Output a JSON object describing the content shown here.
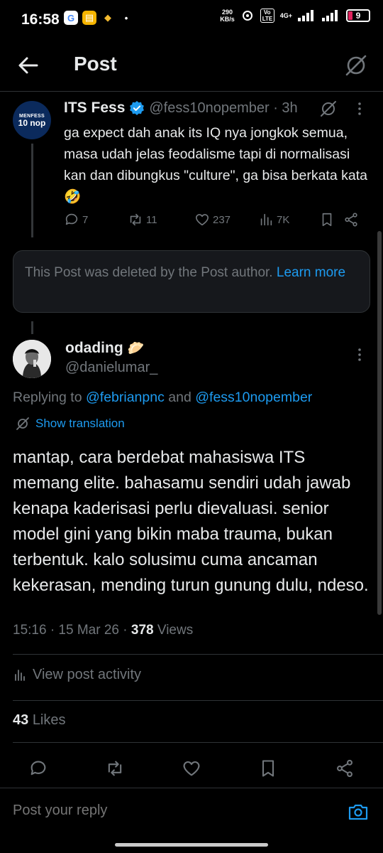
{
  "status_bar": {
    "time": "16:58",
    "apps": [
      {
        "icon": "google-icon",
        "glyph": "G",
        "bg": "#ffffff",
        "fg": "#4285f4"
      },
      {
        "icon": "notes-app-icon",
        "glyph": "▤",
        "bg": "#f5b400",
        "fg": "#ffffff"
      },
      {
        "icon": "binance-icon",
        "glyph": "◆",
        "bg": "#000000",
        "fg": "#f3ba2f"
      },
      {
        "icon": "more-dots-icon",
        "glyph": "•",
        "bg": "#000000",
        "fg": "#ffffff"
      }
    ],
    "speed_value": "290",
    "speed_unit": "KB/s",
    "volte": "Vo LTE",
    "network": "4G+",
    "battery": "9"
  },
  "header": {
    "title": "Post"
  },
  "parent_post": {
    "avatar_line1": "MENFESS",
    "avatar_line2": "10 nop",
    "name": "ITS Fess",
    "handle_time": "@fess10nopember · 3h",
    "text": "ga expect dah anak its IQ nya jongkok semua, masa udah jelas feodalisme tapi di normalisasi kan dan dibungkus \"culture\", ga bisa berkata kata 🤣",
    "replies": "7",
    "reposts": "11",
    "likes": "237",
    "views": "7K"
  },
  "deleted_notice": {
    "text": "This Post was deleted by the Post author.",
    "link": "Learn more"
  },
  "main_post": {
    "name": "odading",
    "name_emoji": "🥟",
    "handle": "@danielumar_",
    "replying_prefix": "Replying to",
    "mention1": "@febrianpnc",
    "replying_and": "and",
    "mention2": "@fess10nopember",
    "show_translation": "Show translation",
    "text": "mantap, cara berdebat mahasiswa ITS memang elite. bahasamu sendiri udah jawab kenapa kaderisasi perlu dievaluasi. senior model gini yang bikin maba trauma, bukan terbentuk. kalo solusimu cuma ancaman kekerasan, mending turun gunung dulu, ndeso.",
    "time_date": "15:16 · 15 Mar 26 ·",
    "views_count": "378",
    "views_label": "Views",
    "activity": "View post activity",
    "likes_count": "43",
    "likes_label": "Likes"
  },
  "reply_bar": {
    "placeholder": "Post your reply"
  },
  "colors": {
    "background": "#000000",
    "accent": "#1d9bf0",
    "muted": "#71767b",
    "text": "#e7e9ea",
    "border": "#2f3336"
  }
}
